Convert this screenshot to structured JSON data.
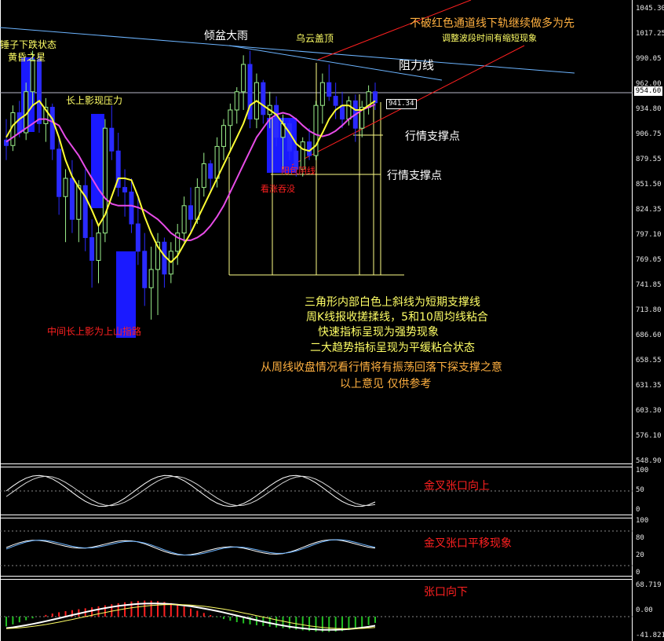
{
  "colors": {
    "up": "#9cf08c",
    "down": "#2a2aff",
    "ma5": "#ffff33",
    "ma10": "#e84ce8",
    "red": "#ff2020",
    "blue_line": "#6cb4ff",
    "text_yellow": "#ffff66",
    "text_orange": "#ffb040",
    "text_white": "#ffffff",
    "grid": "#ffffff"
  },
  "price_axis": {
    "ticks": [
      "1045.30",
      "1017.25",
      "990.05",
      "962.00",
      "934.80",
      "906.75",
      "879.55",
      "851.50",
      "824.35",
      "797.10",
      "769.05",
      "741.85",
      "713.80",
      "686.60",
      "658.55",
      "631.35",
      "603.30",
      "576.10",
      "548.90"
    ],
    "current_price": "954.60",
    "ma_label": "941.34"
  },
  "osc1_axis": {
    "ticks": [
      "100",
      "50",
      "0"
    ]
  },
  "osc2_axis": {
    "ticks": [
      "100",
      "80",
      "20",
      "0"
    ]
  },
  "macd_axis": {
    "ticks": [
      "68.719",
      "0.00",
      "-41.821"
    ]
  },
  "annotations": {
    "hammer": "锤子下跌状态",
    "evening_star": "黄昏之星",
    "long_upper_shadow": "长上影现压力",
    "middle_upper_shadow": "中间长上影为上山指路",
    "tilted_basin": "倾盆大雨",
    "dark_cloud": "乌云盖顶",
    "resistance": "阻力线",
    "red_channel": "不破红色通道线下轨继续做多为先",
    "wave_time": "调整波段时间有缩短现象",
    "support1": "行情支撑点",
    "support2": "行情支撑点",
    "bullish_engulf": "看涨吞没",
    "sunny_engulf": "阳包阴线",
    "analysis": [
      "三角形内部白色上斜线为短期支撑线",
      "周K线报收搓揉线，5和10周均线粘合",
      "快速指标呈现为强势现象",
      "二大趋势指标呈现为平缓粘合状态",
      "从周线收盘情况看行情将有振荡回落下探支撑之意",
      "以上意见 仅供参考"
    ],
    "osc1": "金叉张口向上",
    "osc2": "金叉张口平移现象",
    "macd": "张口向下"
  },
  "chart_data": [
    {
      "type": "candlestick",
      "title": "",
      "ylim": [
        548.9,
        1045.3
      ],
      "candles": [
        [
          902,
          925,
          880,
          896
        ],
        [
          896,
          940,
          890,
          932
        ],
        [
          932,
          945,
          905,
          910
        ],
        [
          910,
          965,
          902,
          955
        ],
        [
          955,
          1000,
          940,
          990
        ],
        [
          990,
          995,
          910,
          920
        ],
        [
          920,
          948,
          900,
          938
        ],
        [
          938,
          942,
          880,
          892
        ],
        [
          892,
          905,
          820,
          840
        ],
        [
          840,
          870,
          790,
          860
        ],
        [
          860,
          880,
          800,
          815
        ],
        [
          815,
          858,
          790,
          852
        ],
        [
          852,
          870,
          780,
          795
        ],
        [
          795,
          815,
          740,
          770
        ],
        [
          770,
          808,
          745,
          800
        ],
        [
          800,
          925,
          790,
          915
        ],
        [
          915,
          940,
          880,
          890
        ],
        [
          890,
          910,
          840,
          850
        ],
        [
          850,
          870,
          818,
          845
        ],
        [
          845,
          860,
          800,
          810
        ],
        [
          810,
          840,
          765,
          780
        ],
        [
          780,
          800,
          720,
          740
        ],
        [
          740,
          785,
          705,
          760
        ],
        [
          760,
          800,
          710,
          790
        ],
        [
          790,
          795,
          740,
          755
        ],
        [
          755,
          790,
          745,
          780
        ],
        [
          780,
          810,
          765,
          800
        ],
        [
          800,
          840,
          790,
          830
        ],
        [
          830,
          850,
          800,
          815
        ],
        [
          815,
          860,
          810,
          850
        ],
        [
          850,
          888,
          840,
          876
        ],
        [
          876,
          880,
          845,
          860
        ],
        [
          860,
          905,
          850,
          895
        ],
        [
          895,
          925,
          880,
          918
        ],
        [
          918,
          942,
          890,
          935
        ],
        [
          935,
          960,
          920,
          955
        ],
        [
          955,
          995,
          935,
          985
        ],
        [
          985,
          1000,
          915,
          925
        ],
        [
          925,
          975,
          915,
          965
        ],
        [
          965,
          968,
          920,
          930
        ],
        [
          930,
          955,
          915,
          940
        ],
        [
          940,
          950,
          895,
          905
        ],
        [
          905,
          930,
          870,
          920
        ],
        [
          920,
          925,
          880,
          890
        ],
        [
          890,
          905,
          862,
          870
        ],
        [
          870,
          905,
          862,
          900
        ],
        [
          900,
          915,
          880,
          885
        ],
        [
          885,
          945,
          880,
          940
        ],
        [
          940,
          975,
          920,
          965
        ],
        [
          965,
          985,
          945,
          950
        ],
        [
          950,
          965,
          925,
          940
        ],
        [
          940,
          955,
          915,
          925
        ],
        [
          925,
          950,
          918,
          945
        ],
        [
          945,
          952,
          900,
          915
        ],
        [
          915,
          945,
          905,
          938
        ],
        [
          938,
          962,
          930,
          955
        ],
        [
          955,
          965,
          935,
          943
        ]
      ],
      "ma5": [
        905,
        918,
        925,
        930,
        940,
        945,
        935,
        925,
        905,
        880,
        862,
        850,
        840,
        825,
        808,
        820,
        840,
        860,
        860,
        858,
        840,
        818,
        800,
        785,
        775,
        768,
        775,
        788,
        800,
        815,
        830,
        845,
        860,
        875,
        890,
        905,
        920,
        940,
        945,
        940,
        935,
        930,
        920,
        910,
        898,
        892,
        890,
        896,
        910,
        925,
        935,
        940,
        940,
        935,
        935,
        940,
        945
      ],
      "ma10": [
        900,
        905,
        910,
        915,
        920,
        925,
        925,
        922,
        918,
        905,
        895,
        885,
        872,
        860,
        848,
        838,
        832,
        830,
        830,
        830,
        828,
        825,
        820,
        815,
        808,
        800,
        795,
        792,
        792,
        795,
        800,
        808,
        818,
        830,
        845,
        860,
        875,
        890,
        905,
        915,
        925,
        930,
        932,
        930,
        925,
        918,
        912,
        908,
        906,
        908,
        912,
        918,
        925,
        930,
        935,
        938,
        941
      ]
    }
  ]
}
